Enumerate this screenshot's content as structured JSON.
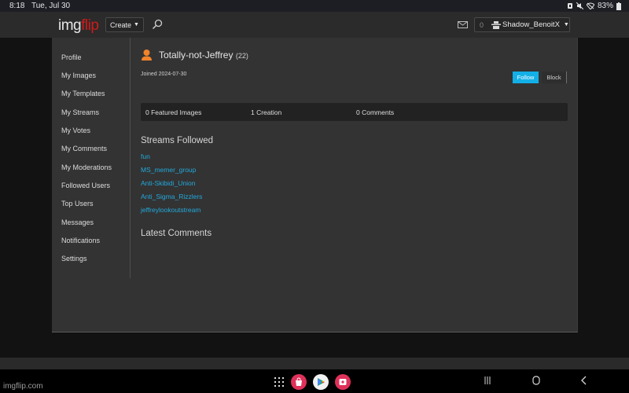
{
  "status_bar": {
    "time": "8:18",
    "date": "Tue, Jul 30",
    "battery": "83%"
  },
  "header": {
    "logo_part1": "img",
    "logo_part2": "flip",
    "create_label": "Create",
    "notification_count": "0",
    "username": "Shadow_BenoitX",
    "icons": [
      "search-icon",
      "mail-icon",
      "user-icon",
      "chevron-down-icon"
    ]
  },
  "sidebar": {
    "items": [
      {
        "label": "Profile"
      },
      {
        "label": "My Images"
      },
      {
        "label": "My Templates"
      },
      {
        "label": "My Streams"
      },
      {
        "label": "My Votes"
      },
      {
        "label": "My Comments"
      },
      {
        "label": "My Moderations"
      },
      {
        "label": "Followed Users"
      },
      {
        "label": "Top Users"
      },
      {
        "label": "Messages"
      },
      {
        "label": "Notifications"
      },
      {
        "label": "Settings"
      }
    ]
  },
  "profile": {
    "username": "Totally-not-Jeffrey",
    "points": "(22)",
    "joined": "Joined 2024-07-30",
    "follow_label": "Follow",
    "block_label": "Block",
    "stats": {
      "featured": "0 Featured Images",
      "creations": "1 Creation",
      "comments": "0 Comments"
    },
    "streams_title": "Streams Followed",
    "streams": [
      {
        "label": "fun"
      },
      {
        "label": "MS_memer_group"
      },
      {
        "label": "Anti-Skibidi_Union"
      },
      {
        "label": "Anti_Sigma_Rizzlers"
      },
      {
        "label": "jeffreylookoutstream"
      }
    ],
    "latest_comments_title": "Latest Comments"
  },
  "colors": {
    "accent": "#13b0e8",
    "link": "#22a9db",
    "logo_red": "#d11a1a",
    "avatar_orange": "#f0832a"
  },
  "footer": {
    "url": "imgflip.com"
  }
}
